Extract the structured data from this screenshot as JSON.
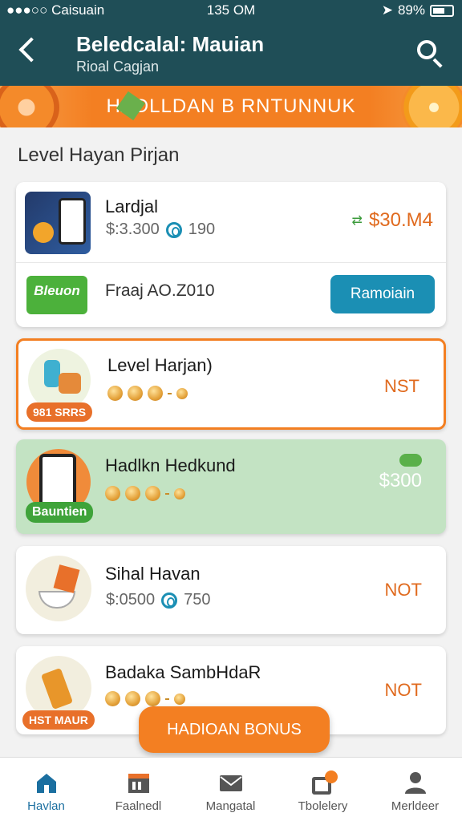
{
  "status_bar": {
    "carrier": "●●●○○ Caisuain",
    "time": "135 OM",
    "battery": "89%"
  },
  "header": {
    "title": "Beledcalal: Mauian",
    "subtitle": "Rioal Cagjan"
  },
  "banner": {
    "text": "HADLLDAN B RNTUNNUK"
  },
  "section": {
    "title": "Level Hayan Pirjan"
  },
  "items": [
    {
      "name": "Lardjal",
      "price": "$:3.300",
      "points": "190",
      "reward": "$30.M4"
    },
    {
      "name": "Level Harjan)",
      "status": "NST",
      "badge": "981 SRRS"
    },
    {
      "name": "Hadlkn Hedkund",
      "reward": "$300",
      "badge": "Bauntien"
    },
    {
      "name": "Sihal Havan",
      "price": "$:0500",
      "points": "750",
      "status": "NOT"
    },
    {
      "name": "Badaka SambHdaR",
      "status": "NOT",
      "badge": "HST MAUR"
    }
  ],
  "promo": {
    "tag": "Bleuon",
    "text": "Fraaj AO.Z010",
    "button": "Ramoiain"
  },
  "fab": {
    "label": "HADIOAN BONUS"
  },
  "bottom_nav": [
    {
      "label": "Havlan",
      "icon": "home-icon"
    },
    {
      "label": "Faalnedl",
      "icon": "store-icon"
    },
    {
      "label": "Mangatal",
      "icon": "mail-icon"
    },
    {
      "label": "Tbolelery",
      "icon": "wallet-icon"
    },
    {
      "label": "Merldeer",
      "icon": "user-icon"
    }
  ],
  "colors": {
    "header": "#1f4e57",
    "accent": "#f37f22",
    "blue": "#1b8fb4",
    "highlight_green": "#c3e3c3"
  }
}
